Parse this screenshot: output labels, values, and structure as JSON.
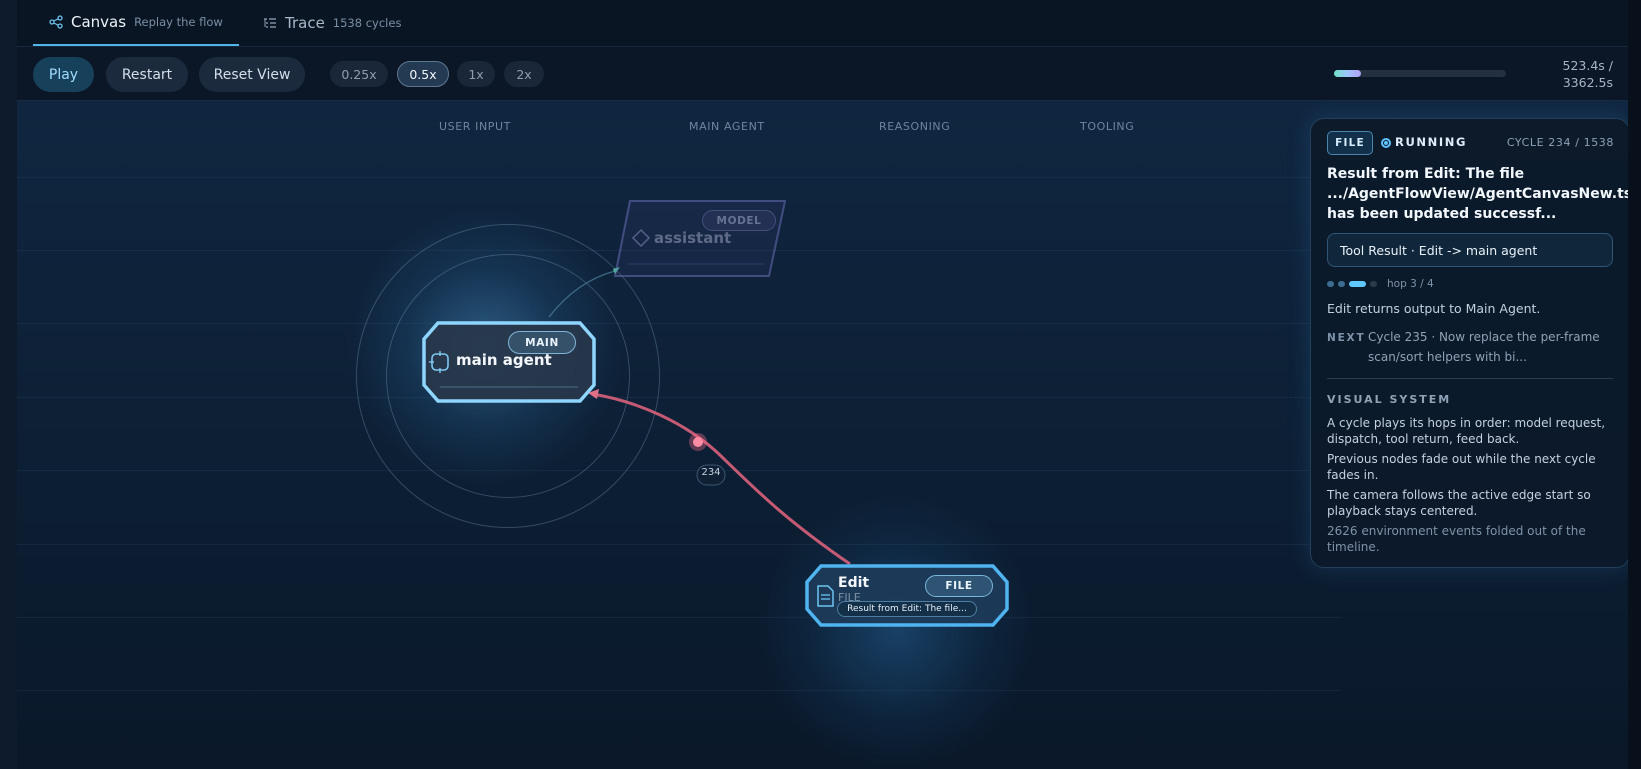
{
  "tabs": [
    {
      "label": "Canvas",
      "subtitle": "Replay the flow",
      "active": true,
      "icon": "share-nodes-icon"
    },
    {
      "label": "Trace",
      "subtitle": "1538 cycles",
      "active": false,
      "icon": "list-tree-icon"
    }
  ],
  "toolbar": {
    "play_label": "Play",
    "restart_label": "Restart",
    "reset_view_label": "Reset View",
    "speeds": [
      "0.25x",
      "0.5x",
      "1x",
      "2x"
    ],
    "selected_speed": "0.5x",
    "progress_fraction": 0.156,
    "time_elapsed": "523.4s /",
    "time_total": "3362.5s"
  },
  "lanes": [
    "USER INPUT",
    "MAIN AGENT",
    "REASONING",
    "TOOLING"
  ],
  "nodes": {
    "assistant": {
      "label": "assistant",
      "tag": "MODEL",
      "icon": "diamond-icon"
    },
    "main_agent": {
      "label": "main agent",
      "tag": "MAIN",
      "icon": "crosshair-icon"
    },
    "edit": {
      "label": "Edit",
      "sublabel": "FILE",
      "tag": "FILE",
      "caption": "Result from Edit: The file...",
      "icon": "document-icon"
    }
  },
  "edge": {
    "cycle_label": "234"
  },
  "panel": {
    "badge": "FILE",
    "status": "RUNNING",
    "cycle": "CYCLE 234 / 1538",
    "title": "Result from Edit: The file .../AgentFlowView/AgentCanvasNew.tsx has been updated successf...",
    "route": "Tool Result · Edit -> main agent",
    "hop": "hop 3 / 4",
    "description": "Edit returns output to Main Agent.",
    "next_label": "NEXT",
    "next_text": "Cycle 235 · Now replace the per-frame scan/sort helpers with bi...",
    "visual_system_label": "VISUAL SYSTEM",
    "visual_system_lines": [
      "A cycle plays its hops in order: model request, dispatch, tool return, feed back.",
      "Previous nodes fade out while the next cycle fades in.",
      "The camera follows the active edge start so playback stays centered.",
      "2626 environment events folded out of the timeline."
    ]
  },
  "colors": {
    "accent": "#4fb4e8",
    "active_edge": "#d8607a",
    "node_border": "#7fd0ff",
    "panel_bg": "#0c1929"
  }
}
